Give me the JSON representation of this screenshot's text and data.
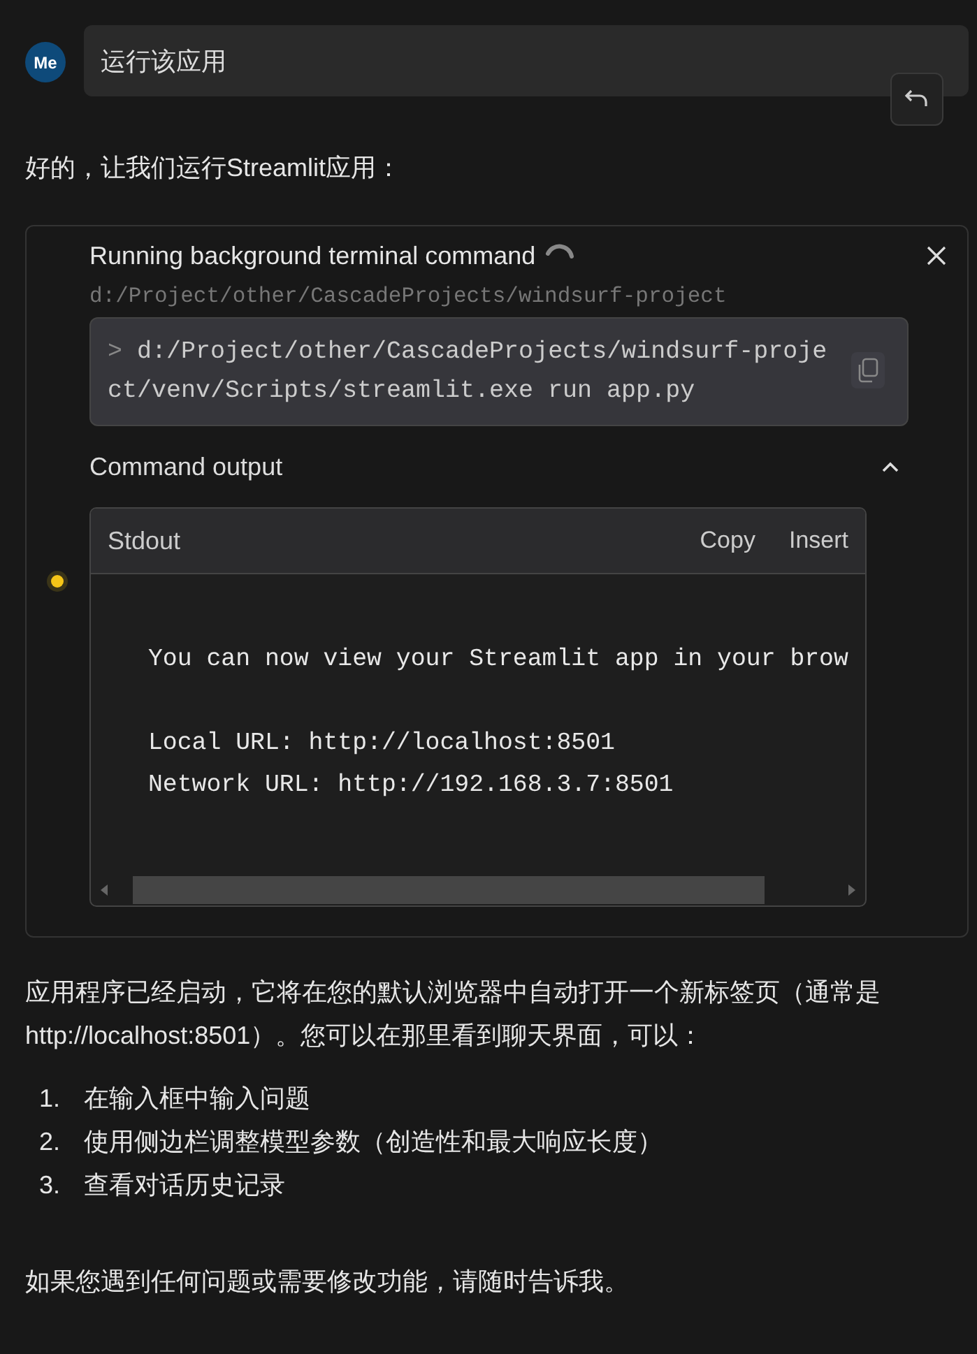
{
  "user_message": {
    "avatar": "Me",
    "text": "运行该应用"
  },
  "reply_intro": "好的，让我们运行Streamlit应用：",
  "command_card": {
    "title": "Running background terminal command",
    "running": true,
    "cwd": "d:/Project/other/CascadeProjects/windsurf-project",
    "prompt": ">",
    "command": "d:/Project/other/CascadeProjects/windsurf-project/venv/Scripts/streamlit.exe run app.py",
    "output_section": {
      "label": "Command output",
      "expanded": true,
      "stream": "Stdout",
      "actions": [
        "Copy",
        "Insert"
      ],
      "lines": [
        {
          "text": "You can now view your Streamlit app in your brow",
          "gap_before": true
        },
        {
          "text": "Local URL: http://localhost:8501",
          "gap_before": true
        },
        {
          "text": "Network URL: http://192.168.3.7:8501",
          "gap_before": false
        }
      ]
    }
  },
  "reply_body": "应用程序已经启动，它将在您的默认浏览器中自动打开一个新标签页（通常是 http://localhost:8501）。您可以在那里看到聊天界面，可以：",
  "steps": [
    {
      "number": "1.",
      "text": "在输入框中输入问题"
    },
    {
      "number": "2.",
      "text": "使用侧边栏调整模型参数（创造性和最大响应长度）"
    },
    {
      "number": "3.",
      "text": "查看对话历史记录"
    }
  ],
  "closing": "如果您遇到任何问题或需要修改功能，请随时告诉我。"
}
